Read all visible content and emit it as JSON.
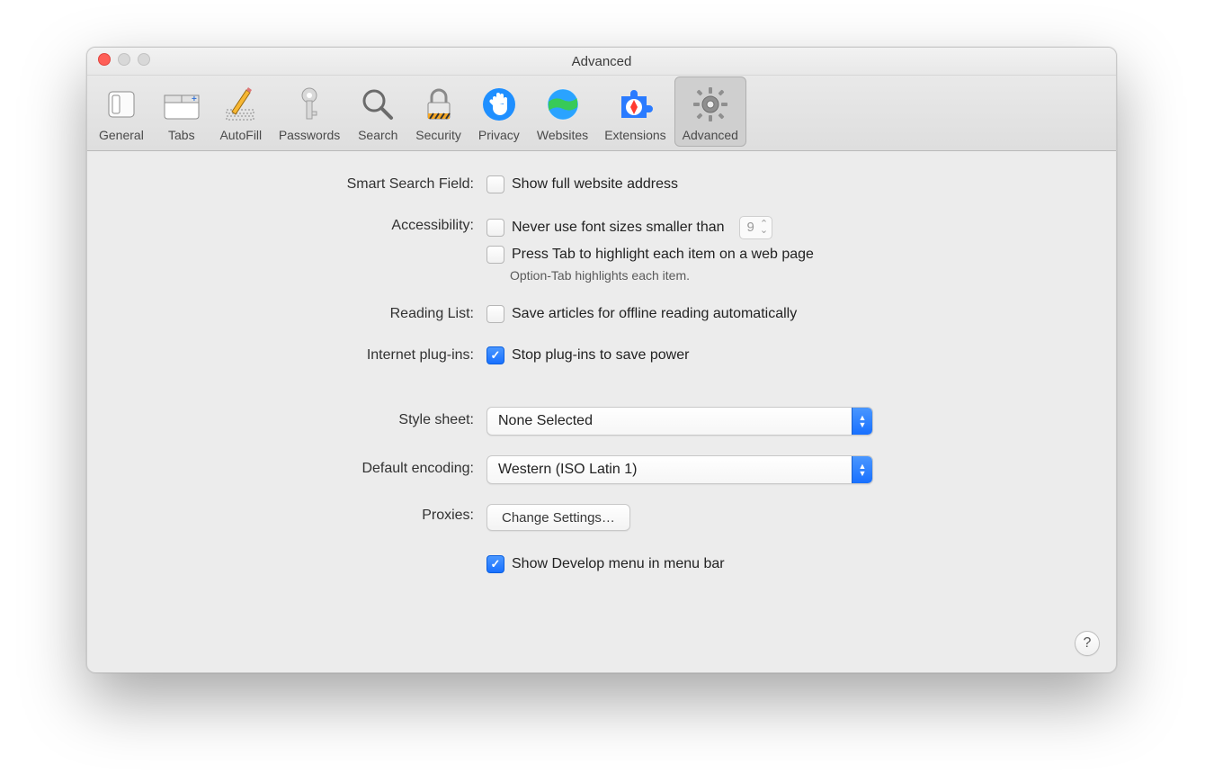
{
  "window": {
    "title": "Advanced"
  },
  "toolbar": {
    "tabs": [
      {
        "id": "general",
        "label": "General"
      },
      {
        "id": "tabs",
        "label": "Tabs"
      },
      {
        "id": "autofill",
        "label": "AutoFill"
      },
      {
        "id": "passwords",
        "label": "Passwords"
      },
      {
        "id": "search",
        "label": "Search"
      },
      {
        "id": "security",
        "label": "Security"
      },
      {
        "id": "privacy",
        "label": "Privacy"
      },
      {
        "id": "websites",
        "label": "Websites"
      },
      {
        "id": "extensions",
        "label": "Extensions"
      },
      {
        "id": "advanced",
        "label": "Advanced"
      }
    ],
    "active": "advanced"
  },
  "sections": {
    "smart_search": {
      "label": "Smart Search Field:",
      "show_full_url": {
        "checked": false,
        "label": "Show full website address"
      }
    },
    "accessibility": {
      "label": "Accessibility:",
      "min_font": {
        "checked": false,
        "label": "Never use font sizes smaller than",
        "value": "9"
      },
      "tab_highlight": {
        "checked": false,
        "label": "Press Tab to highlight each item on a web page"
      },
      "hint": "Option-Tab highlights each item."
    },
    "reading_list": {
      "label": "Reading List:",
      "save_offline": {
        "checked": false,
        "label": "Save articles for offline reading automatically"
      }
    },
    "plugins": {
      "label": "Internet plug-ins:",
      "stop_power": {
        "checked": true,
        "label": "Stop plug-ins to save power"
      }
    },
    "style_sheet": {
      "label": "Style sheet:",
      "value": "None Selected"
    },
    "encoding": {
      "label": "Default encoding:",
      "value": "Western (ISO Latin 1)"
    },
    "proxies": {
      "label": "Proxies:",
      "button": "Change Settings…"
    },
    "develop": {
      "checked": true,
      "label": "Show Develop menu in menu bar"
    }
  },
  "help": "?"
}
